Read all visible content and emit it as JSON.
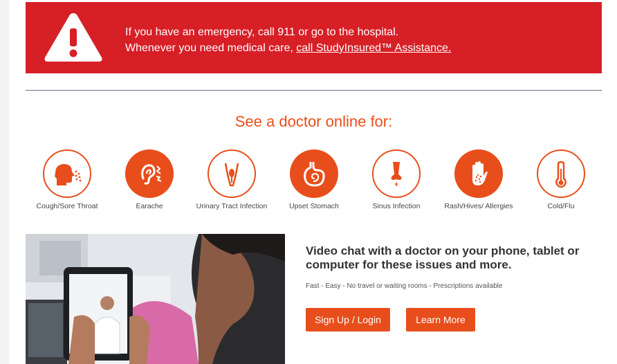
{
  "alert": {
    "line1": "If you have an emergency, call 911 or go to the hospital.",
    "line2_prefix": "Whenever you need medical care, ",
    "line2_link": "call StudyInsured™ Assistance.",
    "color": "#d71f26"
  },
  "heading": "See a doctor online for:",
  "accent_color": "#e84e1b",
  "conditions": [
    {
      "label": "Cough/Sore Throat",
      "icon": "cough-icon",
      "style": "outline"
    },
    {
      "label": "Earache",
      "icon": "ear-icon",
      "style": "filled"
    },
    {
      "label": "Urinary Tract Infection",
      "icon": "urinary-icon",
      "style": "outline"
    },
    {
      "label": "Upset Stomach",
      "icon": "stomach-icon",
      "style": "filled"
    },
    {
      "label": "Sinus Infection",
      "icon": "nose-icon",
      "style": "outline"
    },
    {
      "label": "Rash/Hives/ Allergies",
      "icon": "hand-rash-icon",
      "style": "filled"
    },
    {
      "label": "Cold/Flu",
      "icon": "thermometer-icon",
      "style": "outline"
    }
  ],
  "promo": {
    "title": "Video chat with a doctor on your phone, tablet or computer for these issues and more.",
    "subtitle": "Fast - Easy - No travel or waiting rooms - Prescriptions available",
    "signup_label": "Sign Up / Login",
    "learn_label": "Learn More"
  }
}
